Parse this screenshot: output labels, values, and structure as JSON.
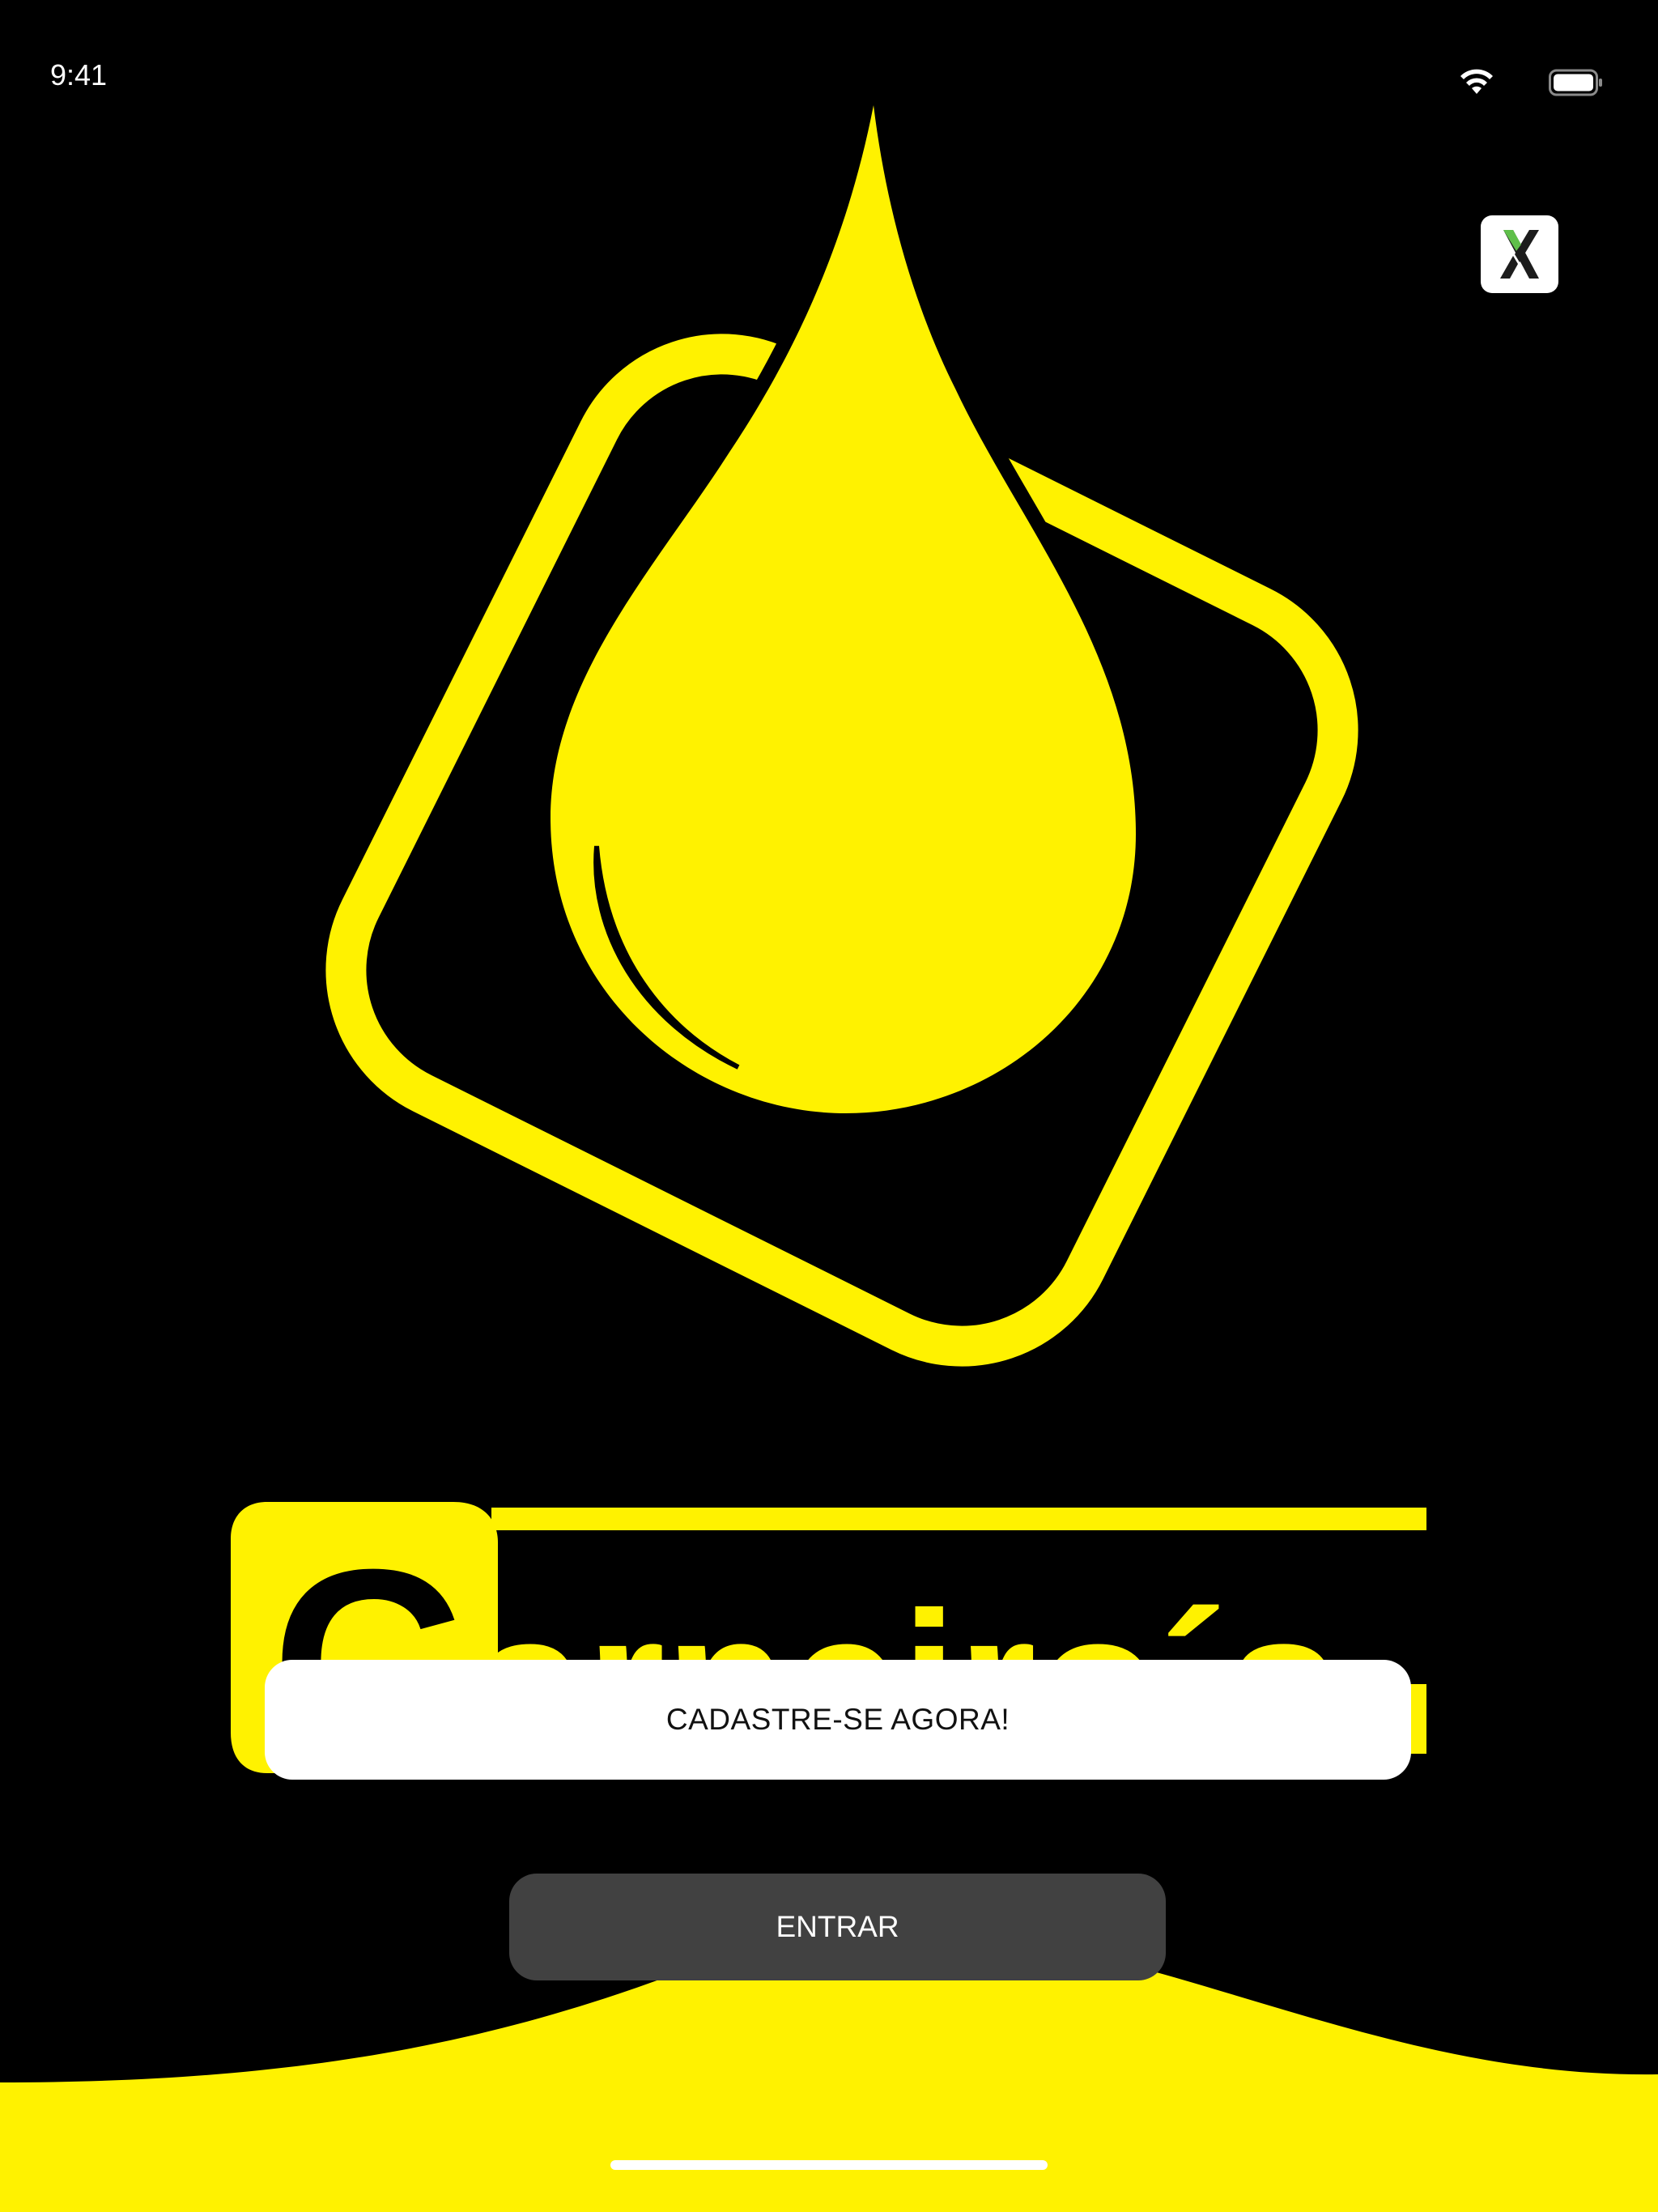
{
  "status_bar": {
    "time": "9:41",
    "wifi_icon": "wifi-icon",
    "battery_icon": "battery-icon"
  },
  "close_icon": "x-icon",
  "logo": {
    "wordmark": "Carneiro´s",
    "icon": "oil-drop-icon"
  },
  "actions": {
    "signup_label": "CADASTRE-SE AGORA!",
    "login_label": "ENTRAR"
  },
  "colors": {
    "background": "#000000",
    "brand_yellow": "#FFF200",
    "signup_button_bg": "#FFFFFF",
    "login_button_bg": "#414141"
  }
}
